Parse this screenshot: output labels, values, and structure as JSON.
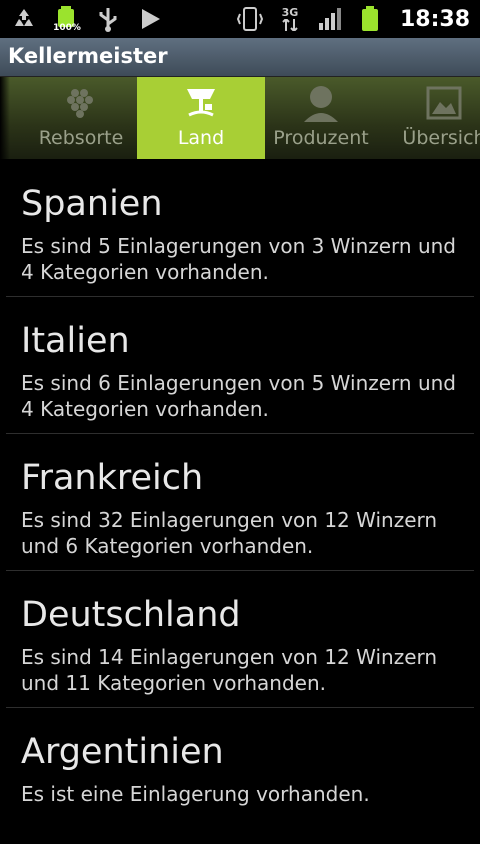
{
  "statusbar": {
    "battery_percent": "100%",
    "network": "3G",
    "time": "18:38",
    "icons": [
      "recycle-icon",
      "battery-icon",
      "usb-icon",
      "play-icon",
      "vibrate-icon",
      "network-3g-icon",
      "signal-icon",
      "battery-icon"
    ]
  },
  "app": {
    "title": "Kellermeister"
  },
  "tabs": [
    {
      "label": "Rebsorte",
      "icon": "grapes-icon",
      "active": false
    },
    {
      "label": "Land",
      "icon": "land-icon",
      "active": true
    },
    {
      "label": "Produzent",
      "icon": "person-icon",
      "active": false
    },
    {
      "label": "Übersich",
      "icon": "picture-icon",
      "active": false
    }
  ],
  "colors": {
    "accent": "#a8cf35",
    "background": "#000000",
    "titlebar": "#4e5d6c"
  },
  "countries": [
    {
      "name": "Spanien",
      "summary": "Es sind 5 Einlagerungen von 3 Winzern und 4 Kategorien vorhanden."
    },
    {
      "name": "Italien",
      "summary": "Es sind 6 Einlagerungen von 5 Winzern und 4 Kategorien vorhanden."
    },
    {
      "name": "Frankreich",
      "summary": "Es sind 32 Einlagerungen von 12 Winzern und 6 Kategorien vorhanden."
    },
    {
      "name": "Deutschland",
      "summary": "Es sind 14 Einlagerungen von 12 Winzern und 11 Kategorien vorhanden."
    },
    {
      "name": "Argentinien",
      "summary": "Es ist eine Einlagerung vorhanden."
    }
  ]
}
